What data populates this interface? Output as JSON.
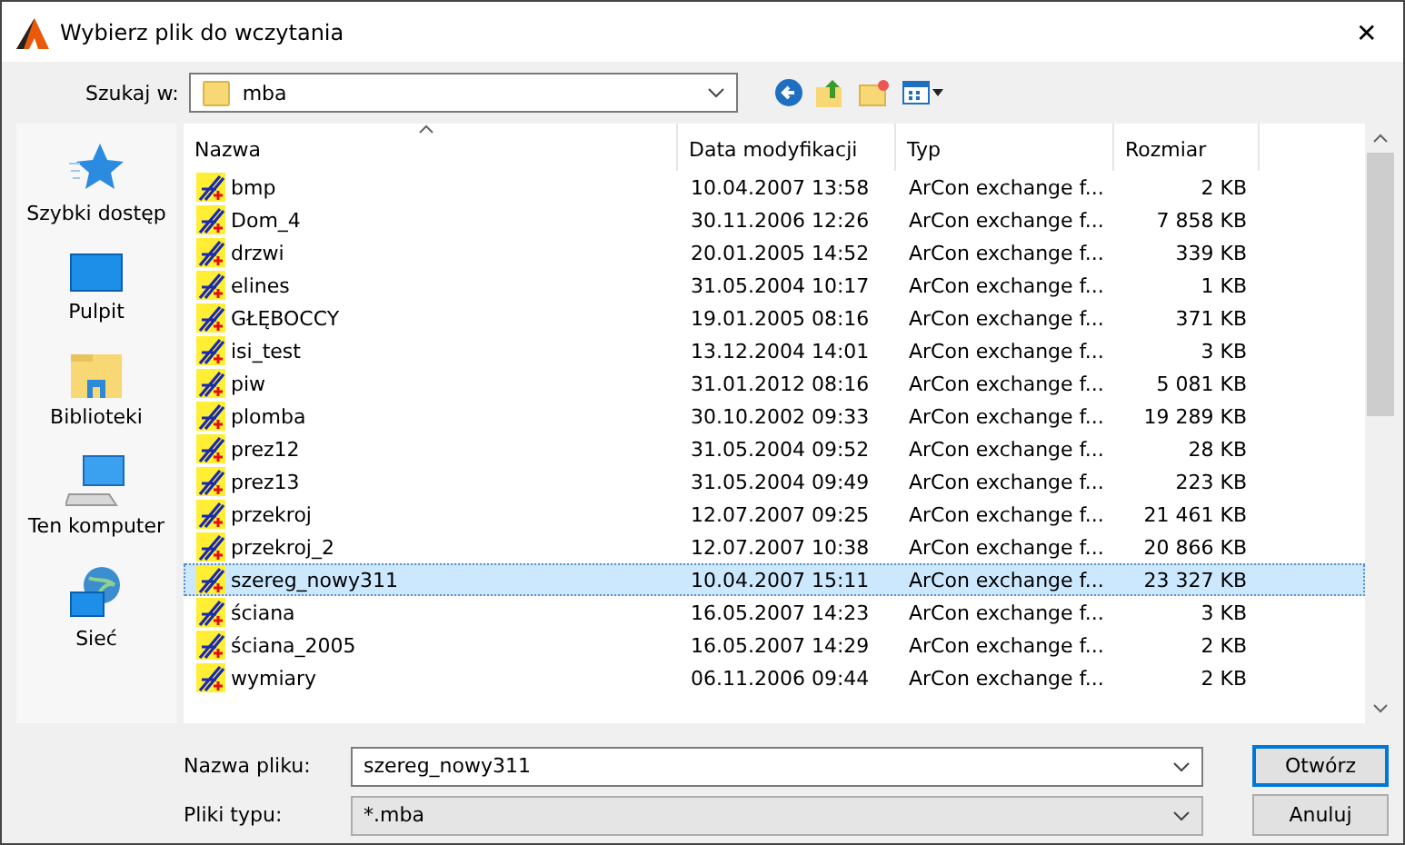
{
  "window": {
    "title": "Wybierz plik do wczytania",
    "close": "✕"
  },
  "look_in": {
    "label": "Szukaj w:",
    "value": "mba"
  },
  "sidebar": {
    "items": [
      {
        "label": "Szybki dostęp",
        "kind": "star",
        "selected": false
      },
      {
        "label": "Pulpit",
        "kind": "desktop",
        "selected": false
      },
      {
        "label": "Biblioteki",
        "kind": "library",
        "selected": false
      },
      {
        "label": "Ten komputer",
        "kind": "computer",
        "selected": false
      },
      {
        "label": "Sieć",
        "kind": "network",
        "selected": false
      }
    ]
  },
  "table": {
    "columns": [
      "Nazwa",
      "Data modyfikacji",
      "Typ",
      "Rozmiar"
    ],
    "rows": [
      {
        "name": "bmp",
        "date": "10.04.2007 13:58",
        "type": "ArCon exchange f...",
        "size": "2 KB",
        "selected": false
      },
      {
        "name": "Dom_4",
        "date": "30.11.2006 12:26",
        "type": "ArCon exchange f...",
        "size": "7 858 KB",
        "selected": false
      },
      {
        "name": "drzwi",
        "date": "20.01.2005 14:52",
        "type": "ArCon exchange f...",
        "size": "339 KB",
        "selected": false
      },
      {
        "name": "elines",
        "date": "31.05.2004 10:17",
        "type": "ArCon exchange f...",
        "size": "1 KB",
        "selected": false
      },
      {
        "name": "GŁĘBOCCY",
        "date": "19.01.2005 08:16",
        "type": "ArCon exchange f...",
        "size": "371 KB",
        "selected": false
      },
      {
        "name": "isi_test",
        "date": "13.12.2004 14:01",
        "type": "ArCon exchange f...",
        "size": "3 KB",
        "selected": false
      },
      {
        "name": "piw",
        "date": "31.01.2012 08:16",
        "type": "ArCon exchange f...",
        "size": "5 081 KB",
        "selected": false
      },
      {
        "name": "plomba",
        "date": "30.10.2002 09:33",
        "type": "ArCon exchange f...",
        "size": "19 289 KB",
        "selected": false
      },
      {
        "name": "prez12",
        "date": "31.05.2004 09:52",
        "type": "ArCon exchange f...",
        "size": "28 KB",
        "selected": false
      },
      {
        "name": "prez13",
        "date": "31.05.2004 09:49",
        "type": "ArCon exchange f...",
        "size": "223 KB",
        "selected": false
      },
      {
        "name": "przekroj",
        "date": "12.07.2007 09:25",
        "type": "ArCon exchange f...",
        "size": "21 461 KB",
        "selected": false
      },
      {
        "name": "przekroj_2",
        "date": "12.07.2007 10:38",
        "type": "ArCon exchange f...",
        "size": "20 866 KB",
        "selected": false
      },
      {
        "name": "szereg_nowy311",
        "date": "10.04.2007 15:11",
        "type": "ArCon exchange f...",
        "size": "23 327 KB",
        "selected": true
      },
      {
        "name": "ściana",
        "date": "16.05.2007 14:23",
        "type": "ArCon exchange f...",
        "size": "3 KB",
        "selected": false
      },
      {
        "name": "ściana_2005",
        "date": "16.05.2007 14:29",
        "type": "ArCon exchange f...",
        "size": "2 KB",
        "selected": false
      },
      {
        "name": "wymiary",
        "date": "06.11.2006 09:44",
        "type": "ArCon exchange f...",
        "size": "2 KB",
        "selected": false
      }
    ]
  },
  "file_name": {
    "label": "Nazwa pliku:",
    "value": "szereg_nowy311"
  },
  "file_type": {
    "label": "Pliki typu:",
    "value": "*.mba"
  },
  "buttons": [
    "Otwórz",
    "Anuluj"
  ]
}
